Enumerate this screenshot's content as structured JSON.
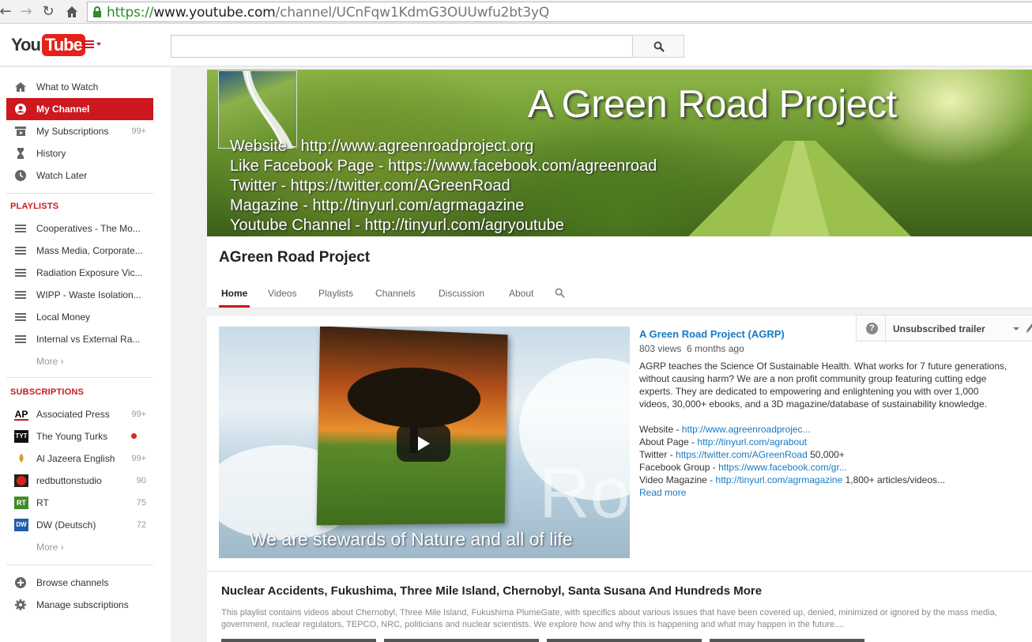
{
  "browser": {
    "url_scheme": "https://",
    "url_host": "www.youtube.com",
    "url_path": "/channel/UCnFqw1KdmG3OUUwfu2bt3yQ"
  },
  "masthead": {
    "logo_you": "You",
    "logo_tube": "Tube",
    "search_placeholder": ""
  },
  "sidebar": {
    "items": [
      {
        "label": "What to Watch",
        "icon": "home-icon"
      },
      {
        "label": "My Channel",
        "icon": "user-icon"
      },
      {
        "label": "My Subscriptions",
        "count": "99+",
        "icon": "subscriptions-icon"
      },
      {
        "label": "History",
        "icon": "hourglass-icon"
      },
      {
        "label": "Watch Later",
        "icon": "clock-icon"
      }
    ],
    "playlists_heading": "PLAYLISTS",
    "playlists": [
      {
        "label": "Cooperatives - The Mo..."
      },
      {
        "label": "Mass Media, Corporate..."
      },
      {
        "label": "Radiation Exposure Vic..."
      },
      {
        "label": "WIPP - Waste Isolation..."
      },
      {
        "label": "Local Money"
      },
      {
        "label": "Internal vs External Ra..."
      }
    ],
    "more_label": "More ›",
    "subscriptions_heading": "SUBSCRIPTIONS",
    "subscriptions": [
      {
        "label": "Associated Press",
        "count": "99+",
        "avatar": "AP"
      },
      {
        "label": "The Young Turks",
        "count": "",
        "avatar": "TYT"
      },
      {
        "label": "Al Jazeera English",
        "count": "99+",
        "avatar": ""
      },
      {
        "label": "redbuttonstudio",
        "count": "90",
        "avatar": ""
      },
      {
        "label": "RT",
        "count": "75",
        "avatar": "RT"
      },
      {
        "label": "DW (Deutsch)",
        "count": "72",
        "avatar": "DW"
      }
    ],
    "browse_channels": "Browse channels",
    "manage_subscriptions": "Manage subscriptions"
  },
  "banner": {
    "title": "A Green Road Project",
    "lines": [
      "Website - http://www.agreenroadproject.org",
      "Like Facebook Page - https://www.facebook.com/agreenroad",
      "Twitter - https://twitter.com/AGreenRoad",
      "Magazine - http://tinyurl.com/agrmagazine",
      "Youtube Channel - http://tinyurl.com/agryoutube"
    ]
  },
  "channel": {
    "name": "AGreen Road Project",
    "tabs": [
      "Home",
      "Videos",
      "Playlists",
      "Channels",
      "Discussion",
      "About"
    ]
  },
  "trailer": {
    "label": "Unsubscribed trailer",
    "help": "?"
  },
  "video": {
    "overlay_text": "Ro",
    "caption": "We are stewards of Nature and all of life",
    "title": "A Green Road Project (AGRP)",
    "views": "803 views",
    "age": "6 months ago",
    "description": "AGRP teaches the Science Of Sustainable Health. What works for 7 future generations, without causing harm? We are a non profit community group featuring cutting edge experts. They are dedicated to empowering and enlightening you with over 1,000 videos, 30,000+ ebooks, and a 3D magazine/database of sustainability knowledge.",
    "links": [
      {
        "prefix": "Website - ",
        "link": "http://www.agreenroadprojec...",
        "suffix": ""
      },
      {
        "prefix": "About Page - ",
        "link": "http://tinyurl.com/agrabout",
        "suffix": ""
      },
      {
        "prefix": "Twitter - ",
        "link": "https://twitter.com/AGreenRoad",
        "suffix": " 50,000+"
      },
      {
        "prefix": "Facebook Group - ",
        "link": "https://www.facebook.com/gr...",
        "suffix": ""
      },
      {
        "prefix": "Video Magazine - ",
        "link": "http://tinyurl.com/agrmagazine",
        "suffix": " 1,800+ articles/videos..."
      }
    ],
    "read_more": "Read more"
  },
  "section": {
    "title": "Nuclear Accidents, Fukushima, Three Mile Island, Chernobyl, Santa Susana And Hundreds More",
    "description": "This playlist contains videos about Chernobyl, Three Mile Island, Fukushima PlumeGate, with specifics about various issues that have been covered up, denied, minimized or ignored by the mass media, government, nuclear regulators, TEPCO, NRC, politicians and nuclear scientists. We explore how and why this is happening and what may happen in the future...."
  },
  "colors": {
    "accent": "#cc181e",
    "link": "#167ac6"
  }
}
